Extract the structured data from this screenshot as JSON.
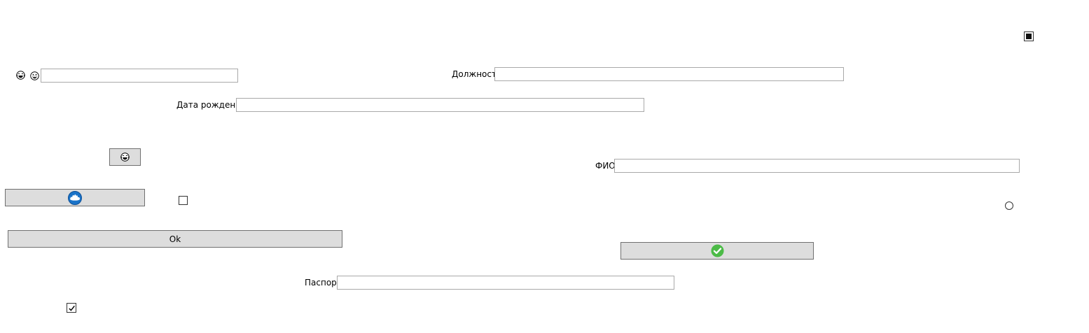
{
  "form": {
    "labels": {
      "position": "Должность",
      "birth_date": "Дата рождения",
      "full_name": "ФИО",
      "passport": "Паспорт"
    },
    "fields": {
      "unlabeled_value": "",
      "position_value": "",
      "birth_date_value": "",
      "full_name_value": "",
      "passport_value": ""
    },
    "buttons": {
      "ok_label": "Ok"
    },
    "icons": {
      "top_right_toggle": "filled-square-checkbox-icon",
      "emoji_a": "laughing-face-icon",
      "emoji_b": "grinning-face-icon",
      "small_button_icon": "laughing-face-icon",
      "wide_button_icon": "blue-splash-icon",
      "confirm_button_icon": "green-check-circle-icon"
    },
    "states": {
      "top_right_toggle_checked": true,
      "mid_checkbox_checked": false,
      "bottom_checkbox_checked": true,
      "radio_checked": false
    },
    "colors": {
      "button_bg": "#dddddd",
      "confirm_green": "#4cbb47",
      "splash_blue": "#1a73c8"
    }
  }
}
